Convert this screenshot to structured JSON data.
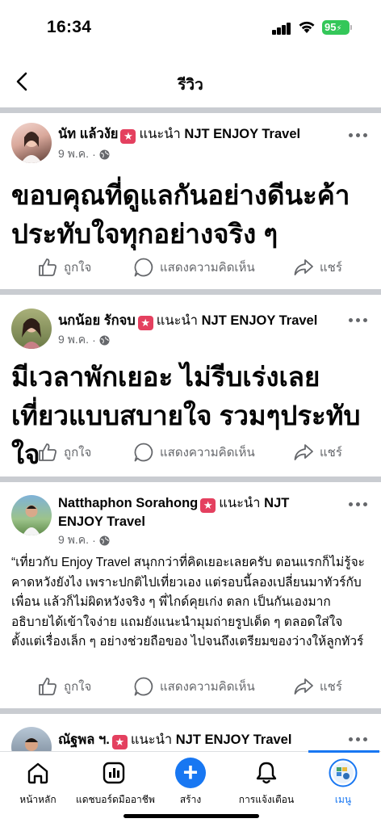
{
  "status": {
    "time": "16:34",
    "battery": "95"
  },
  "header": {
    "title": "รีวิว"
  },
  "posts": [
    {
      "author": "นัท แล้วงัย",
      "recommends": "แนะนำ",
      "page": "NJT ENJOY Travel",
      "date": "9 พ.ค.",
      "text": "ขอบคุณที่ดูแลกันอย่างดีนะค้า ประทับใจทุกอย่างจริง ๆ"
    },
    {
      "author": "นกน้อย รักจบ",
      "recommends": "แนะนำ",
      "page": "NJT ENJOY Travel",
      "date": "9 พ.ค.",
      "text": "มีเวลาพักเยอะ ไม่รีบเร่งเลย เที่ยวแบบสบายใจ รวมๆประทับใจ"
    },
    {
      "author": "Natthaphon Sorahong",
      "recommends": "แนะนำ",
      "page": "NJT ENJOY Travel",
      "date": "9 พ.ค.",
      "text": "“เที่ยวกับ Enjoy Travel สนุกกว่าที่คิดเยอะเลยครับ ตอนแรกก็ไม่รู้จะคาดหวังยังไง เพราะปกติไปเที่ยวเอง แต่รอบนี้ลองเปลี่ยนมาทัวร์กับเพื่อน แล้วก็ไม่ผิดหวังจริง ๆ พี่ไกด์คุยเก่ง ตลก เป็นกันเองมาก อธิบายได้เข้าใจง่าย แถมยังแนะนำมุมถ่ายรูปเด็ด ๆ ตลอดใส่ใจตั้งแต่เรื่องเล็ก ๆ อย่างช่วยถือของ ไปจนถึงเตรียมของว่างให้ลูกทัวร์"
    },
    {
      "author": "ณัฐพล ฯ.",
      "recommends": "แนะนำ",
      "page": "NJT ENJOY Travel"
    }
  ],
  "actions": {
    "like": "ถูกใจ",
    "comment": "แสดงความคิดเห็น",
    "share": "แชร์"
  },
  "nav": {
    "home": "หน้าหลัก",
    "dashboard": "แดชบอร์ดมืออาชีพ",
    "create": "สร้าง",
    "notifications": "การแจ้งเตือน",
    "menu": "เมนู"
  },
  "colors": {
    "accent": "#1877f2",
    "badge": "#e4405f",
    "battery": "#34c759",
    "divider": "#c9ccd1"
  }
}
